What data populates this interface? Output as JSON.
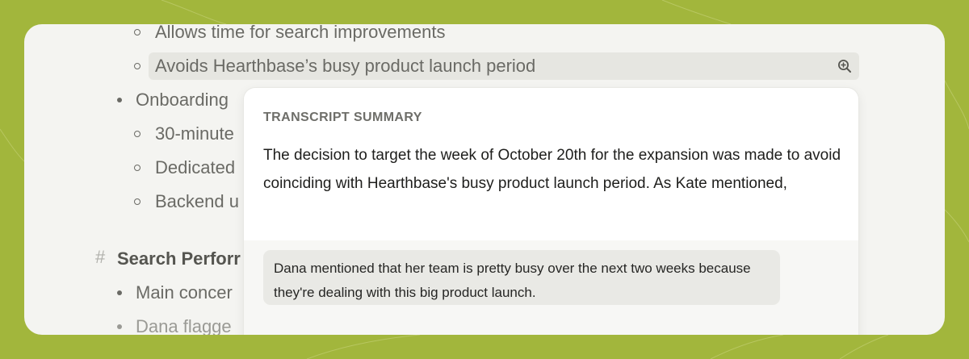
{
  "document": {
    "lines": [
      {
        "text": "Allows time for search improvements"
      },
      {
        "text": "Avoids Hearthbase’s busy product launch period"
      },
      {
        "text": "Onboarding"
      },
      {
        "text": "30-minute"
      },
      {
        "text": "Dedicated"
      },
      {
        "text": "Backend u"
      },
      {
        "text": "Search Perforr"
      },
      {
        "text": "Main concer"
      },
      {
        "text": "Dana flagge"
      }
    ],
    "heading_marker": "#"
  },
  "popover": {
    "title": "TRANSCRIPT SUMMARY",
    "summary": "The decision to target the week of October 20th for the expansion was made to avoid coinciding with Hearthbase's busy product launch period. As Kate mentioned,",
    "quote": "Dana mentioned that her team is pretty busy over the next two weeks because they're dealing with this big product launch."
  },
  "icons": {
    "zoom": "zoom-in-icon"
  },
  "colors": {
    "frame_background": "#a2b63c",
    "card_background": "#f4f4f1",
    "popover_background": "#ffffff",
    "quote_background": "#e9e9e5"
  }
}
